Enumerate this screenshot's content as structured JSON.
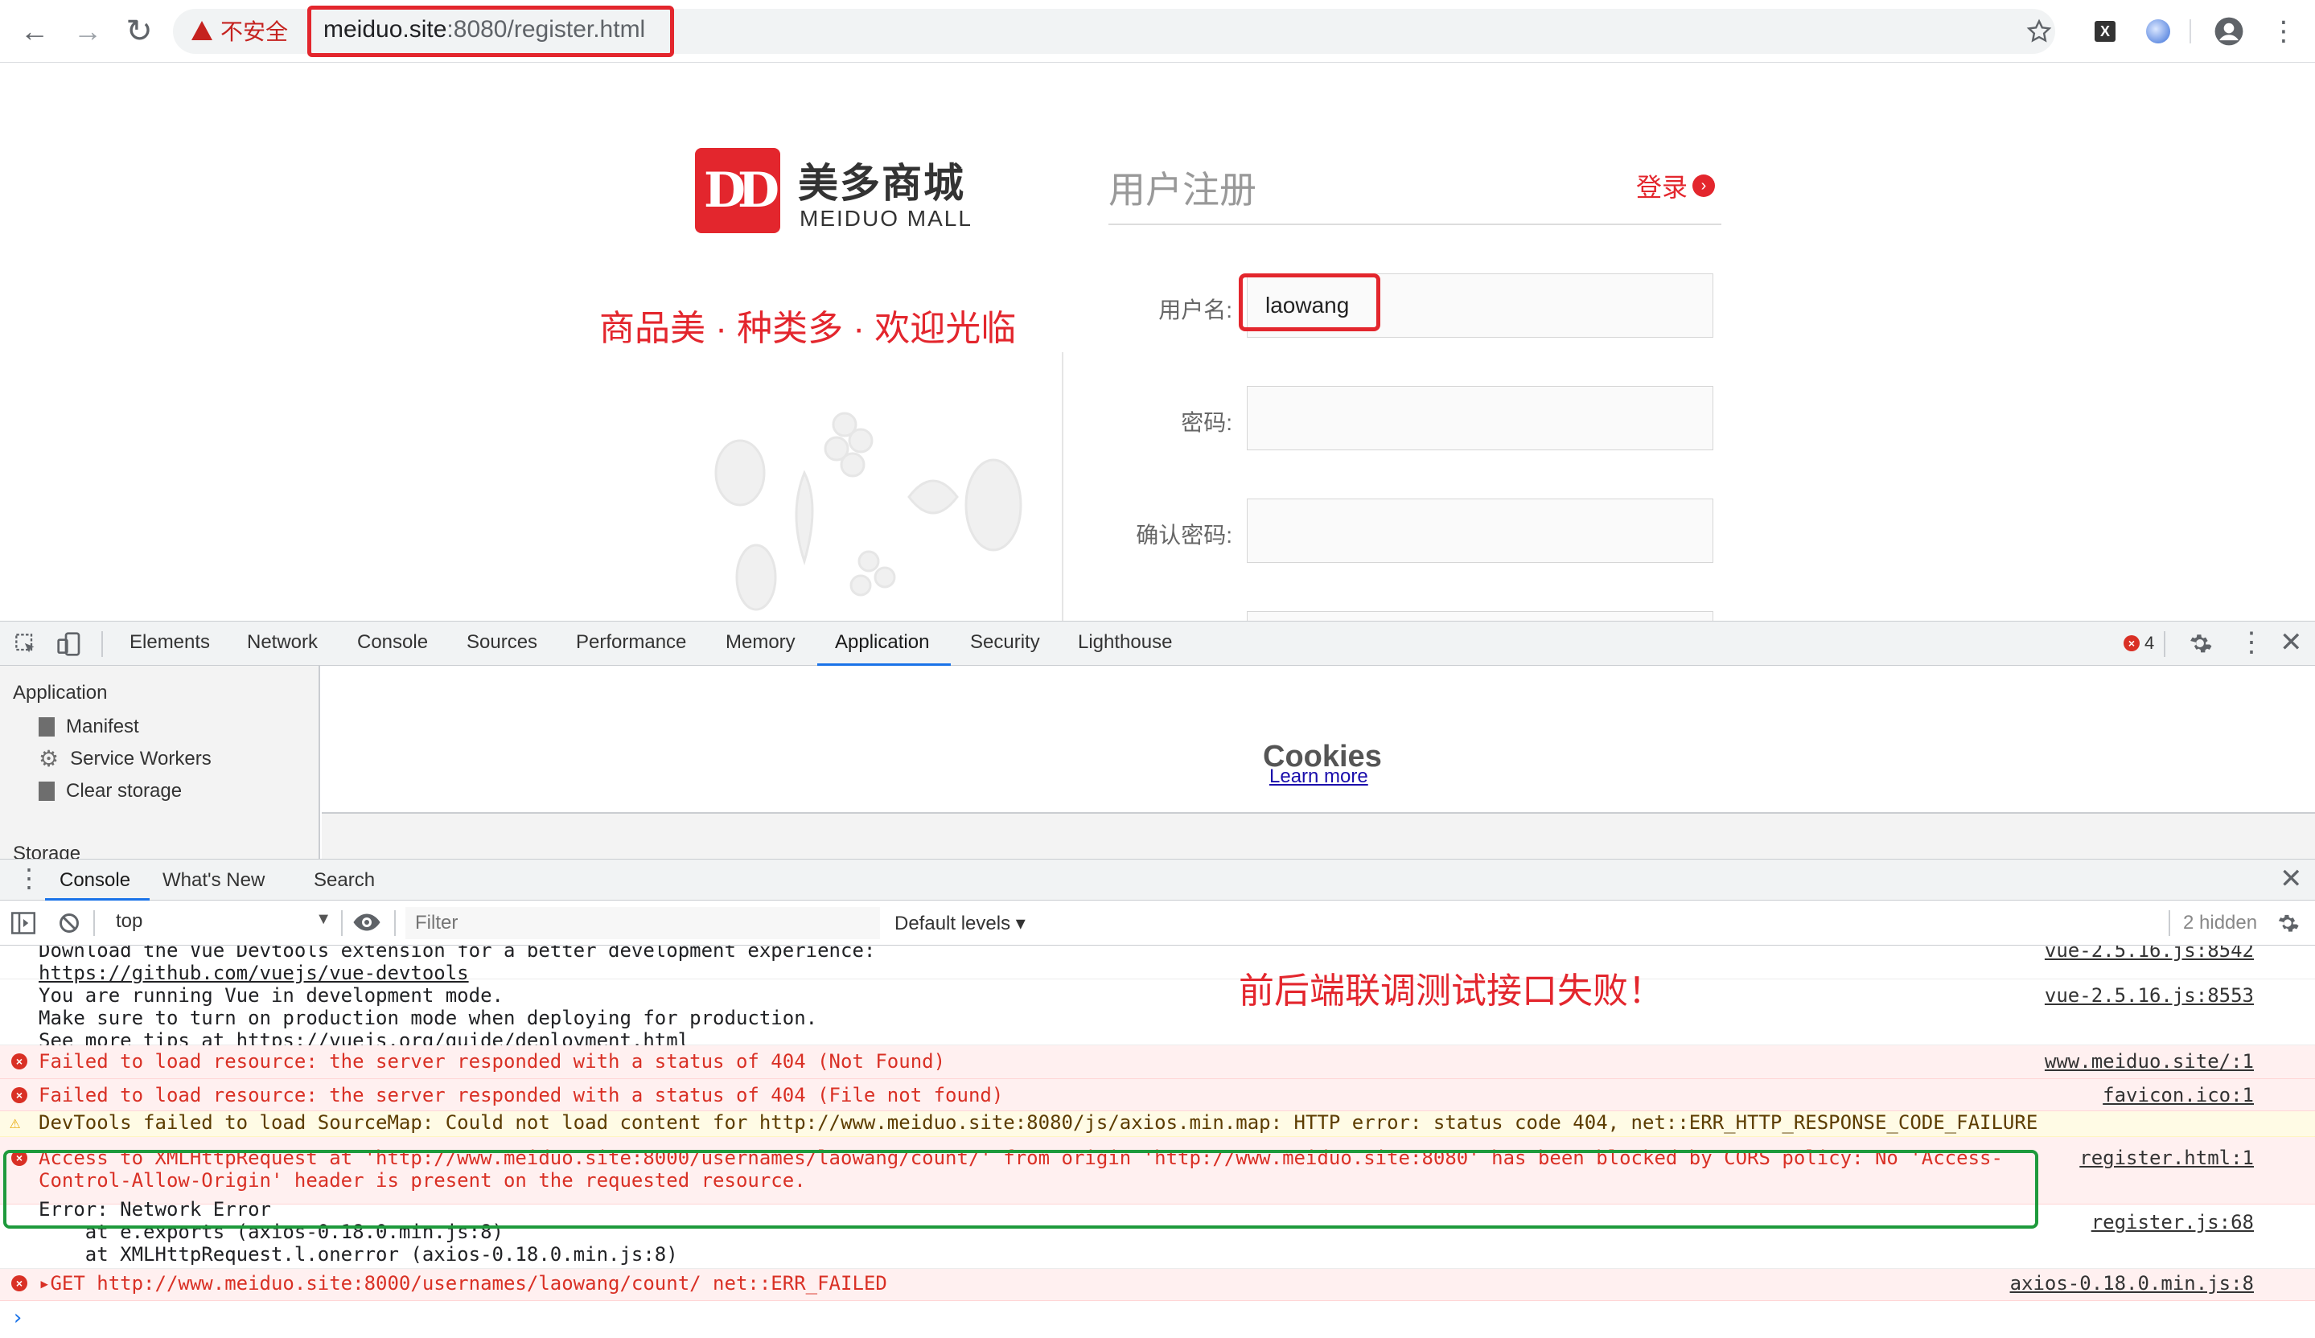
{
  "browser": {
    "security_label": "不安全",
    "url_host": "meiduo.site",
    "url_rest": ":8080/register.html",
    "icons": [
      "back-icon",
      "forward-icon",
      "reload-icon",
      "warning-icon",
      "star-icon",
      "extension-x-icon",
      "extension-circle-icon",
      "profile-icon",
      "menu-dots-icon"
    ]
  },
  "page": {
    "logo_mark": "DD",
    "logo_cn": "美多商城",
    "logo_en": "MEIDUO MALL",
    "slogan": "商品美 · 种类多 · 欢迎光临",
    "title": "用户注册",
    "login_link": "登录",
    "login_arrow": "›",
    "fields": [
      {
        "label": "用户名:",
        "value": "laowang"
      },
      {
        "label": "密码:",
        "value": ""
      },
      {
        "label": "确认密码:",
        "value": ""
      }
    ]
  },
  "devtools": {
    "tabs": [
      "Elements",
      "Network",
      "Console",
      "Sources",
      "Performance",
      "Memory",
      "Application",
      "Security",
      "Lighthouse"
    ],
    "active_tab": "Application",
    "error_count": "4",
    "application": {
      "heading": "Application",
      "items": [
        "Manifest",
        "Service Workers",
        "Clear storage"
      ],
      "storage_heading": "Storage",
      "cookies_title": "Cookies",
      "cookies_link": "Learn more"
    },
    "drawer": {
      "tabs": [
        "Console",
        "What's New",
        "Search"
      ],
      "context": "top",
      "filter_placeholder": "Filter",
      "levels": "Default levels ▾",
      "hidden": "2 hidden"
    },
    "annotation": "前后端联调测试接口失败！",
    "messages": [
      {
        "type": "log",
        "lines": [
          "Download the Vue Devtools extension for a better development experience:",
          "https://github.com/vuejs/vue-devtools"
        ],
        "source": "vue-2.5.16.js:8542"
      },
      {
        "type": "log",
        "lines": [
          "You are running Vue in development mode.",
          "Make sure to turn on production mode when deploying for production.",
          "See more tips at https://vuejs.org/guide/deployment.html"
        ],
        "source": "vue-2.5.16.js:8553"
      },
      {
        "type": "error",
        "lines": [
          "Failed to load resource: the server responded with a status of 404 (Not Found)"
        ],
        "source": "www.meiduo.site/:1"
      },
      {
        "type": "error",
        "lines": [
          "Failed to load resource: the server responded with a status of 404 (File not found)"
        ],
        "source": "favicon.ico:1"
      },
      {
        "type": "warning",
        "lines": [
          "DevTools failed to load SourceMap: Could not load content for http://www.meiduo.site:8080/js/axios.min.map: HTTP error: status code 404, net::ERR_HTTP_RESPONSE_CODE_FAILURE"
        ],
        "source": ""
      },
      {
        "type": "error",
        "lines": [
          "Access to XMLHttpRequest at 'http://www.meiduo.site:8000/usernames/laowang/count/' from origin 'http://www.meiduo.site:8080' has been blocked by CORS policy: No 'Access-",
          "Control-Allow-Origin' header is present on the requested resource."
        ],
        "source": "register.html:1"
      },
      {
        "type": "log",
        "lines": [
          "Error: Network Error",
          "    at e.exports (axios-0.18.0.min.js:8)",
          "    at XMLHttpRequest.l.onerror (axios-0.18.0.min.js:8)"
        ],
        "source": "register.js:68"
      },
      {
        "type": "error",
        "lines": [
          "▸GET http://www.meiduo.site:8000/usernames/laowang/count/ net::ERR_FAILED"
        ],
        "source": "axios-0.18.0.min.js:8"
      }
    ]
  }
}
